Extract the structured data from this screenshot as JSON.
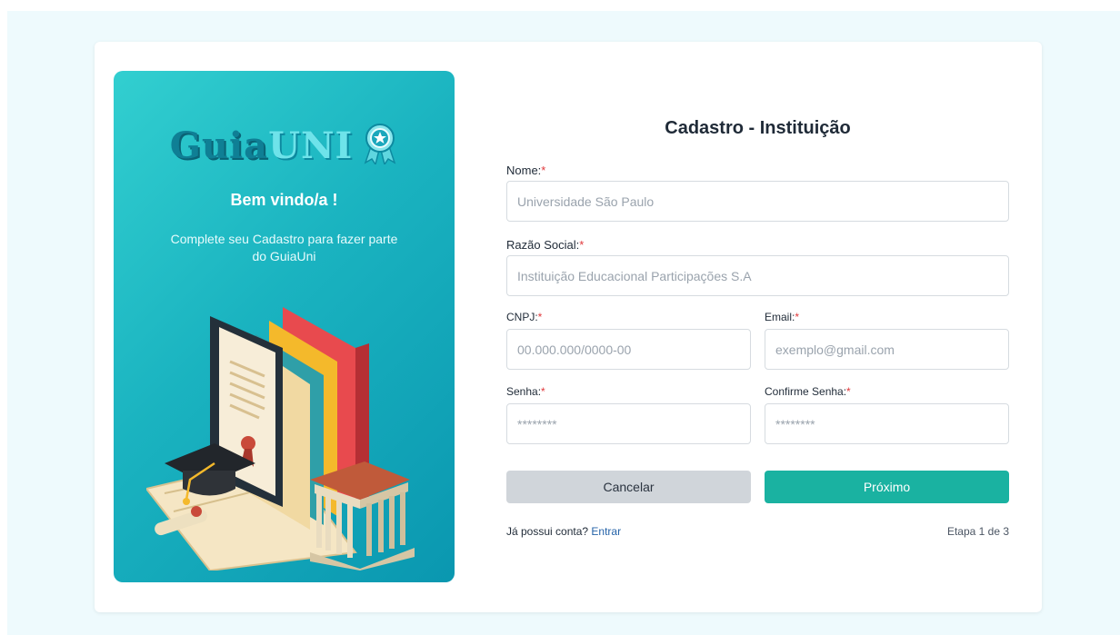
{
  "brand": {
    "logo_part1": "Guia",
    "logo_part2": "UNI",
    "logo_icon": "award-ribbon-icon"
  },
  "welcome": {
    "title": "Bem vindo/a !",
    "subtitle": "Complete seu Cadastro para fazer parte do GuiaUni"
  },
  "form": {
    "title": "Cadastro - Instituição",
    "fields": {
      "nome": {
        "label": "Nome:",
        "required": "*",
        "placeholder": "Universidade São Paulo"
      },
      "razao": {
        "label": "Razão Social:",
        "required": "*",
        "placeholder": "Instituição Educacional Participações S.A"
      },
      "cnpj": {
        "label": "CNPJ:",
        "required": "*",
        "placeholder": "00.000.000/0000-00"
      },
      "email": {
        "label": "Email:",
        "required": "*",
        "placeholder": "exemplo@gmail.com"
      },
      "senha": {
        "label": "Senha:",
        "required": "*",
        "placeholder": "********"
      },
      "confirma": {
        "label": "Confirme Senha:",
        "required": "*",
        "placeholder": "********"
      }
    },
    "buttons": {
      "cancel": "Cancelar",
      "next": "Próximo"
    },
    "footer": {
      "login_prompt": "Já possui conta?",
      "login_link": "Entrar",
      "step": "Etapa 1 de 3"
    }
  },
  "colors": {
    "panel_gradient_start": "#32cfd0",
    "panel_gradient_end": "#0a97b0",
    "primary_button": "#1ab2a1",
    "cancel_button": "#d0d5da",
    "required_mark": "#e0383b",
    "link": "#2563a8"
  }
}
